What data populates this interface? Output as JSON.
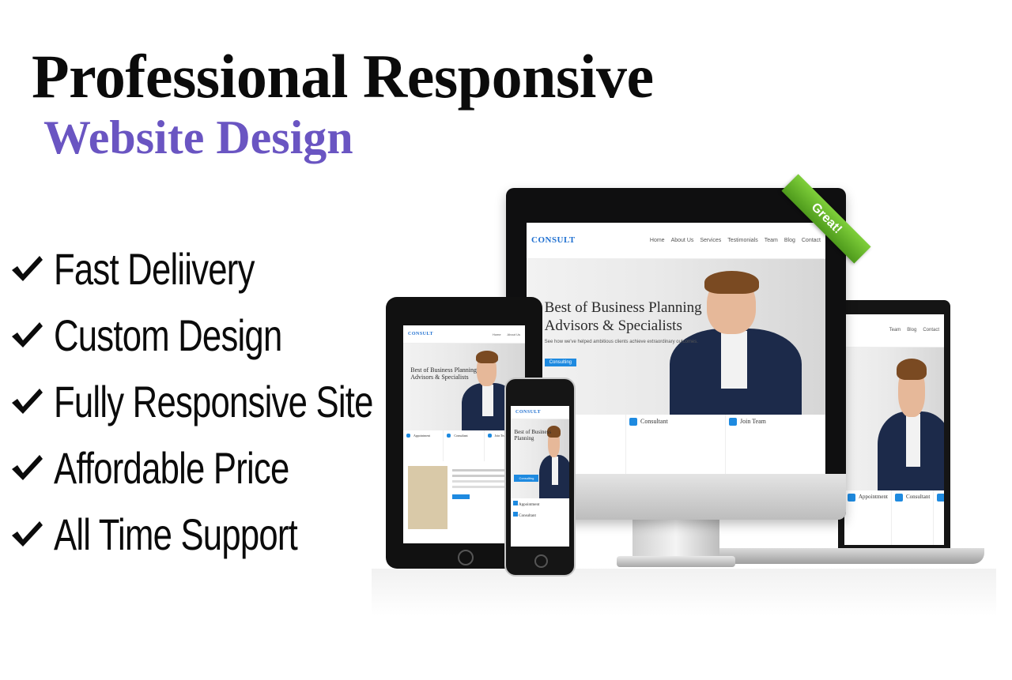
{
  "headline": "Professional Responsive",
  "subheadline": "Website Design",
  "accent_color": "#6a55c2",
  "features": [
    {
      "label": "Fast Deliivery",
      "icon": "checkmark-icon"
    },
    {
      "label": "Custom Design",
      "icon": "checkmark-icon"
    },
    {
      "label": "Fully Responsive Site",
      "icon": "checkmark-icon"
    },
    {
      "label": "Affordable Price",
      "icon": "checkmark-icon"
    },
    {
      "label": "All Time Support",
      "icon": "checkmark-icon"
    }
  ],
  "badge": "Great!",
  "mockup": {
    "brand": "CONSULT",
    "nav": [
      "Home",
      "About Us",
      "Services",
      "Testimonials",
      "Team",
      "Blog",
      "Contact"
    ],
    "hero_title_line1": "Best of Business Planning",
    "hero_title_line2": "Advisors & Specialists",
    "hero_subtitle": "See how we've helped ambitious clients achieve extraordinary outcomes.",
    "hero_button": "Consulting",
    "cards": [
      "Appointment",
      "Consultant",
      "Join Team"
    ]
  }
}
